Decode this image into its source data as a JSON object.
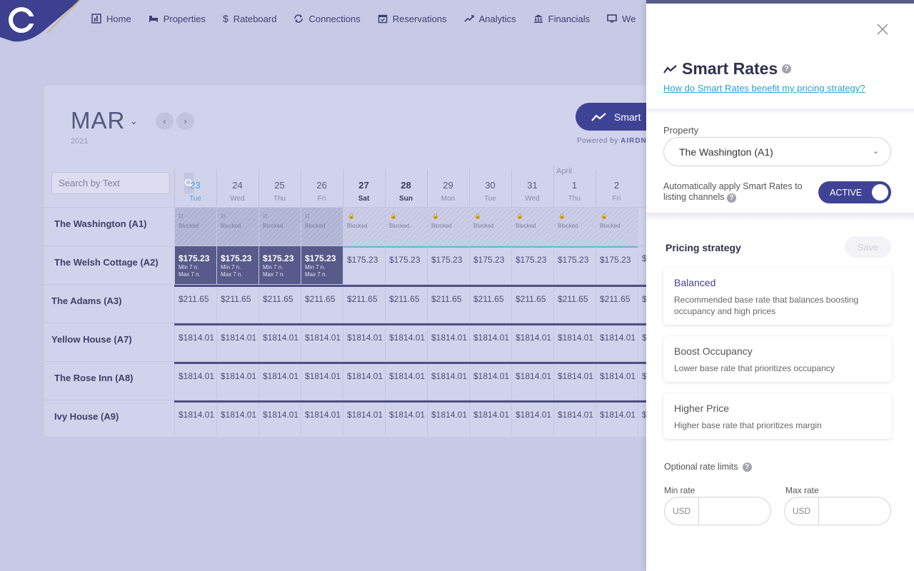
{
  "nav": [
    {
      "label": "Home",
      "icon": "bar-chart-icon"
    },
    {
      "label": "Properties",
      "icon": "bed-icon"
    },
    {
      "label": "Rateboard",
      "icon": "dollar-icon"
    },
    {
      "label": "Connections",
      "icon": "sync-icon"
    },
    {
      "label": "Reservations",
      "icon": "calendar-check-icon"
    },
    {
      "label": "Analytics",
      "icon": "trend-icon"
    },
    {
      "label": "Financials",
      "icon": "bank-icon"
    },
    {
      "label": "We",
      "icon": "monitor-icon"
    }
  ],
  "calendar": {
    "month": "MAR",
    "year": "2021",
    "smart_button": "Smart",
    "powered_by": "Powered by",
    "powered_brand": "AIRDN",
    "search_placeholder": "Search by Text",
    "next_month_label": "April",
    "days": [
      {
        "num": "23",
        "wd": "Tue"
      },
      {
        "num": "24",
        "wd": "Wed"
      },
      {
        "num": "25",
        "wd": "Thu"
      },
      {
        "num": "26",
        "wd": "Fri"
      },
      {
        "num": "27",
        "wd": "Sat"
      },
      {
        "num": "28",
        "wd": "Sun"
      },
      {
        "num": "29",
        "wd": "Mon"
      },
      {
        "num": "30",
        "wd": "Tue"
      },
      {
        "num": "31",
        "wd": "Wed"
      },
      {
        "num": "1",
        "wd": "Thu"
      },
      {
        "num": "2",
        "wd": "Fri"
      }
    ],
    "blocked_label": "Blocked",
    "min_label": "Min 7 n.",
    "max_label": "Max 7 n.",
    "properties": [
      {
        "name": "The Washington (A1)"
      },
      {
        "name": "The Welsh Cottage (A2)",
        "price": "$175.23"
      },
      {
        "name": "The Adams (A3)",
        "price": "$211.65"
      },
      {
        "name": "Yellow House (A7)",
        "price": "$1814.01"
      },
      {
        "name": "The Rose Inn (A8)",
        "price": "$1814.01"
      },
      {
        "name": "Ivy House (A9)",
        "price": "$1814.01"
      }
    ],
    "overflow_cell": "$"
  },
  "panel": {
    "title": "Smart Rates",
    "link": "How do Smart Rates benefit my pricing strategy?",
    "property_label": "Property",
    "property_value": "The Washington (A1)",
    "auto_apply": "Automatically apply Smart Rates to listing channels",
    "toggle_label": "ACTIVE",
    "pricing_title": "Pricing strategy",
    "save_label": "Save",
    "options": [
      {
        "name": "Balanced",
        "desc": "Recommended base rate that balances boosting occupancy and high prices"
      },
      {
        "name": "Boost Occupancy",
        "desc": "Lower base rate that prioritizes occupancy"
      },
      {
        "name": "Higher Price",
        "desc": "Higher base rate that prioritizes margin"
      }
    ],
    "limits_label": "Optional rate limits",
    "min_label": "Min rate",
    "max_label": "Max rate",
    "currency": "USD"
  },
  "colors": {
    "accent": "#3f4396",
    "link": "#2e9ec9",
    "today": "#4ba4d4"
  }
}
